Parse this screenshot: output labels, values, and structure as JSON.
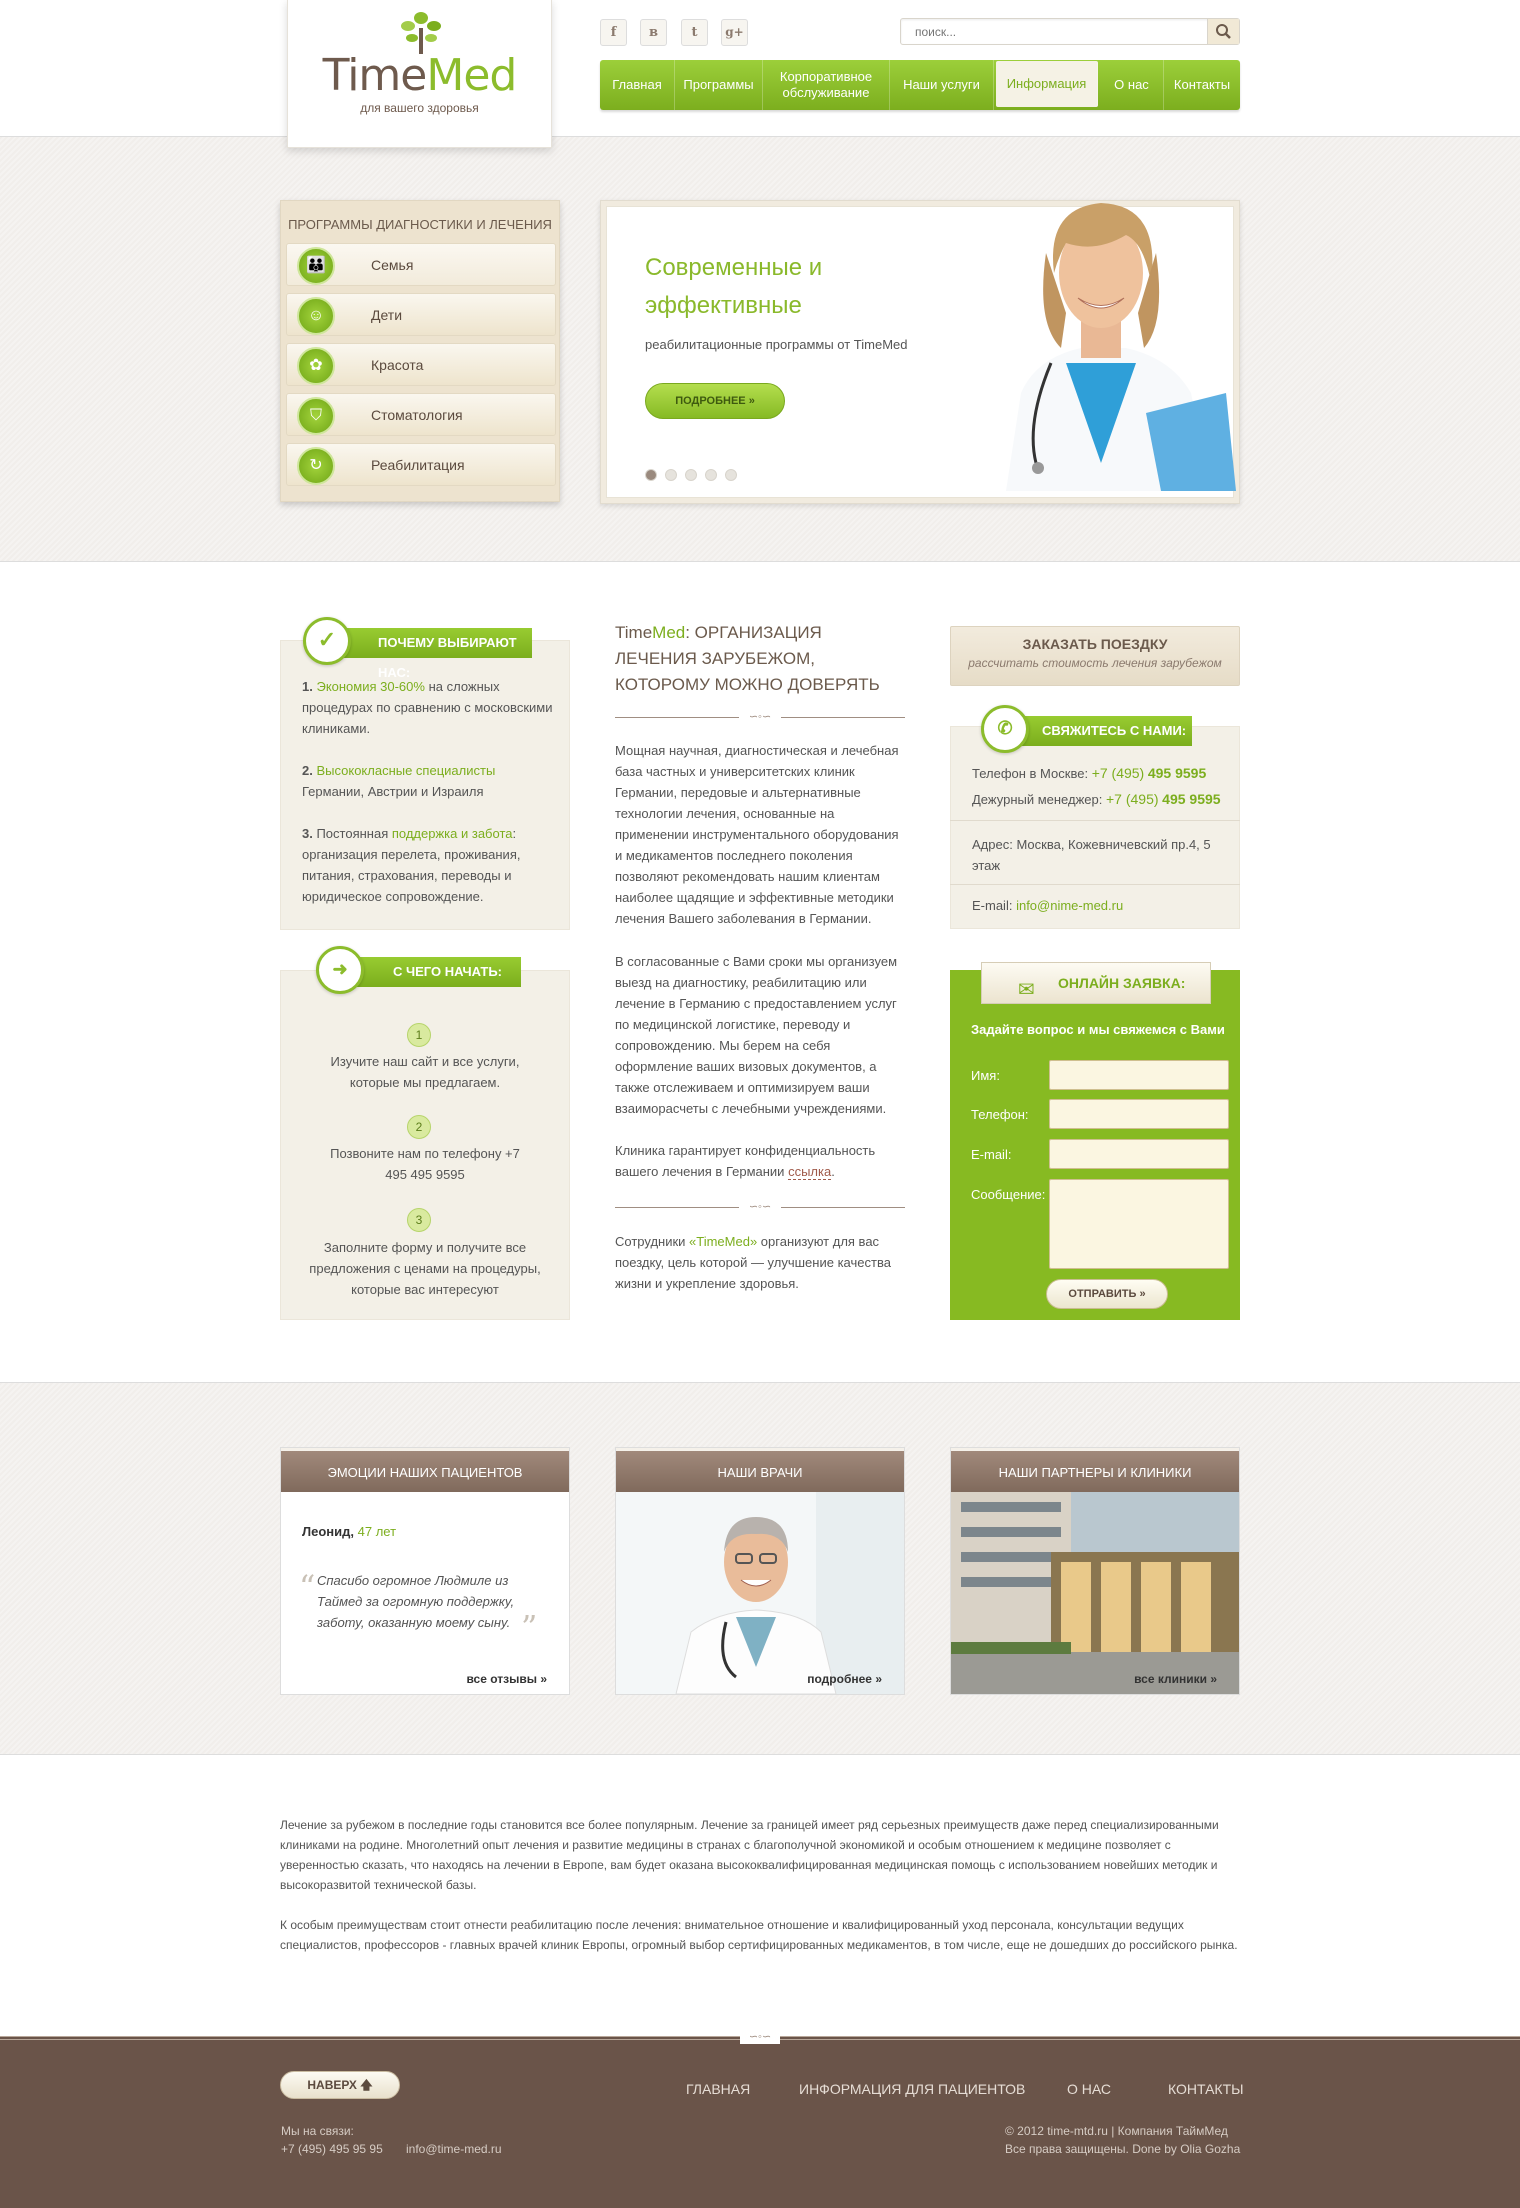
{
  "header": {
    "logo": {
      "word1": "Time",
      "word2": "Med",
      "tagline": "для вашего здоровья"
    },
    "social": [
      {
        "icon": "facebook-icon",
        "glyph": "f"
      },
      {
        "icon": "vk-icon",
        "glyph": "в"
      },
      {
        "icon": "twitter-icon",
        "glyph": "t"
      },
      {
        "icon": "google-plus-icon",
        "glyph": "g+"
      }
    ],
    "search_placeholder": "поиск...",
    "nav": [
      {
        "label": "Главная"
      },
      {
        "label": "Программы"
      },
      {
        "label": "Корпоративное обслуживание"
      },
      {
        "label": "Наши услуги"
      },
      {
        "label": "Информация",
        "active": true
      },
      {
        "label": "О нас"
      },
      {
        "label": "Контакты"
      }
    ]
  },
  "programs": {
    "title": "ПРОГРАММЫ ДИАГНОСТИКИ И ЛЕЧЕНИЯ",
    "items": [
      {
        "label": "Семья",
        "icon": "family-icon",
        "glyph": "👪"
      },
      {
        "label": "Дети",
        "icon": "children-icon",
        "glyph": "☺"
      },
      {
        "label": "Красота",
        "icon": "flower-icon",
        "glyph": "✿"
      },
      {
        "label": "Стоматология",
        "icon": "tooth-icon",
        "glyph": "⛉"
      },
      {
        "label": "Реабилитация",
        "icon": "refresh-icon",
        "glyph": "↻"
      }
    ]
  },
  "slider": {
    "heading": "Современные и эффективные",
    "subtitle": "реабилитационные программы от TimeMed",
    "button": "ПОДРОБНЕЕ",
    "dots": 5,
    "active_dot": 1
  },
  "why": {
    "badge": "ПОЧЕМУ ВЫБИРАЮТ НАС:",
    "points": [
      {
        "num": "1.",
        "highlight": "Экономия 30-60%",
        "text": " на сложных процедурах по сравнению с московскими клиниками."
      },
      {
        "num": "2.",
        "highlight": "Высококласные специалисты",
        "text": " Германии, Австрии и Израиля"
      },
      {
        "num": "3.",
        "pre": " Постоянная ",
        "highlight": "поддержка и забота",
        "text": ": организация перелета, проживания, питания, страхования, переводы и юридическое сопровождение."
      }
    ]
  },
  "start": {
    "badge": "С ЧЕГО НАЧАТЬ:",
    "steps": [
      {
        "num": "1",
        "text": "Изучите наш сайт и все услуги, которые мы предлагаем."
      },
      {
        "num": "2",
        "text": "Позвоните нам по телефону +7 495 495 9595"
      },
      {
        "num": "3",
        "text": "Заполните форму и получите все предложения с ценами на процедуры, которые вас интересуют"
      }
    ]
  },
  "main": {
    "title_brand1": "Time",
    "title_brand2": "Med",
    "title_rest": ": ОРГАНИЗАЦИЯ ЛЕЧЕНИЯ ЗАРУБЕЖОМ, КОТОРОМУ МОЖНО ДОВЕРЯТЬ",
    "p1": "Мощная научная, диагностическая и лечебная база частных и университетских клиник Германии, передовые и альтернативные технологии лечения, основанные на применении инструментального оборудования и медикаментов последнего поколения позволяют рекомендовать нашим клиентам наиболее щадящие и эффективные методики лечения Вашего заболевания в Германии.",
    "p2": "В согласованные с Вами сроки мы организуем выезд на диагностику, реабилитацию или лечение в Германию с предоставлением услуг по медицинской логистике, переводу и сопровождению. Мы берем на себя оформление ваших визовых документов, а также отслеживаем и оптимизируем ваши взаиморасчеты с лечебными учреждениями.",
    "p3": "Клиника гарантирует конфиденциальность вашего лечения в Германии ",
    "p3_link": "ссылка",
    "p4_pre": "Сотрудники ",
    "p4_brand": "«TimeMed»",
    "p4_post": " организуют для вас поездку, цель которой — улучшение качества жизни и укрепление здоровья."
  },
  "order": {
    "title": "ЗАКАЗАТЬ ПОЕЗДКУ",
    "subtitle": "рассчитать стоимость лечения зарубежом"
  },
  "contacts": {
    "badge": "СВЯЖИТЕСЬ С НАМИ:",
    "phone_label": "Телефон в Москве:",
    "phone_code": "+7 (495)",
    "phone_num": "495 9595",
    "manager_label": "Дежурный менеджер:",
    "manager_code": "+7 (495)",
    "manager_num": "495 9595",
    "address": "Адрес: Москва, Кожевничевский пр.4, 5 этаж",
    "email_label": "E-mail:",
    "email": "info@nime-med.ru"
  },
  "form": {
    "badge": "ОНЛАЙН ЗАЯВКА:",
    "prompt": "Задайте вопрос и мы свяжемся с Вами",
    "name_label": "Имя:",
    "phone_label": "Телефон:",
    "email_label": "E-mail:",
    "message_label": "Сообщение:",
    "submit": "ОТПРАВИТЬ"
  },
  "cards": {
    "emotions": {
      "title": "ЭМОЦИИ НАШИХ ПАЦИЕНТОВ",
      "author": "Леонид, ",
      "age": "47 лет",
      "quote": "Спасибо огромное Людмиле из Таймед за огромную поддержку, заботу, оказанную моему сыну.",
      "link": "все отзывы"
    },
    "doctors": {
      "title": "НАШИ ВРАЧИ",
      "link": "подробнее"
    },
    "partners": {
      "title": "НАШИ ПАРТНЕРЫ И КЛИНИКИ",
      "link": "все клиники"
    }
  },
  "seo": {
    "p1": "Лечение за рубежом в последние годы становится все более популярным. Лечение за границей имеет ряд серьезных преимуществ даже перед специализированными клиниками на родине. Многолетний опыт лечения и развитие медицины в странах с благополучной экономикой и особым отношением к медицине позволяет с уверенностью сказать, что находясь на лечении в Европе, вам будет оказана высококвалифицированная медицинская помощь с использованием новейших методик и высокоразвитой технической базы.",
    "p2": "К особым преимуществам стоит отнести реабилитацию после лечения: внимательное отношение и квалифицированный уход персонала, консультации ведущих специалистов, профессоров - главных врачей клиник Европы, огромный выбор сертифицированных медикаментов, в том числе, еще не дошедших до российского рынка."
  },
  "footer": {
    "top_button": "НАВЕРХ",
    "nav": [
      "ГЛАВНАЯ",
      "ИНФОРМАЦИЯ ДЛЯ ПАЦИЕНТОВ",
      "О НАС",
      "КОНТАКТЫ"
    ],
    "contact_label": "Мы на связи:",
    "phone": "+7 (495) 495 95 95",
    "email": "info@time-med.ru",
    "copyright": "© 2012 time-mtd.ru | Компания ТаймМед",
    "rights": "Все права защищены. Done by Olia Gozha"
  },
  "colors": {
    "accent": "#8cbc2c",
    "brown": "#6a5449",
    "beige": "#f3f0e7"
  }
}
